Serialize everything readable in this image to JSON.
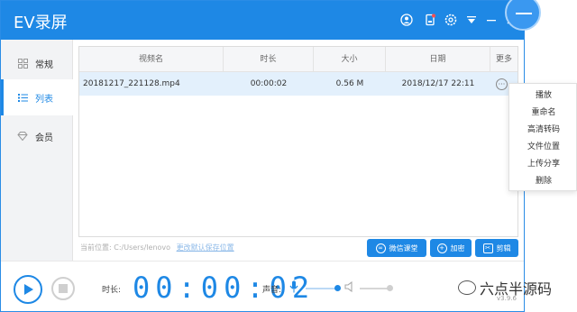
{
  "app": {
    "title": "EV录屏"
  },
  "sidebar": {
    "items": [
      {
        "label": "常规",
        "icon": "grid-icon"
      },
      {
        "label": "列表",
        "icon": "list-icon"
      },
      {
        "label": "会员",
        "icon": "diamond-icon"
      }
    ],
    "active_index": 1
  },
  "table": {
    "headers": [
      "视频名",
      "时长",
      "大小",
      "日期",
      "更多"
    ],
    "rows": [
      {
        "name": "20181217_221128.mp4",
        "duration": "00:00:02",
        "size": "0.56 M",
        "date": "2018/12/17 22:11"
      }
    ]
  },
  "context_menu": {
    "items": [
      "播放",
      "重命名",
      "高清转码",
      "文件位置",
      "上传分享",
      "删除"
    ]
  },
  "footer": {
    "path_label": "当前位置: C:/Users/lenovo",
    "change_path_link": "更改默认保存位置",
    "buttons": [
      "微信课堂",
      "加密",
      "剪辑"
    ]
  },
  "controls": {
    "duration_label": "时长:",
    "timer": "00:00:02",
    "volume_label": "声音:",
    "mic_volume": 1.0,
    "speaker_volume": 1.0
  },
  "watermark": {
    "text": "六点半源码",
    "version": "v3.9.6"
  },
  "colors": {
    "accent": "#1e88e5",
    "row_selected": "#e3f0fc",
    "sidebar_bg": "#f2f3f5"
  }
}
